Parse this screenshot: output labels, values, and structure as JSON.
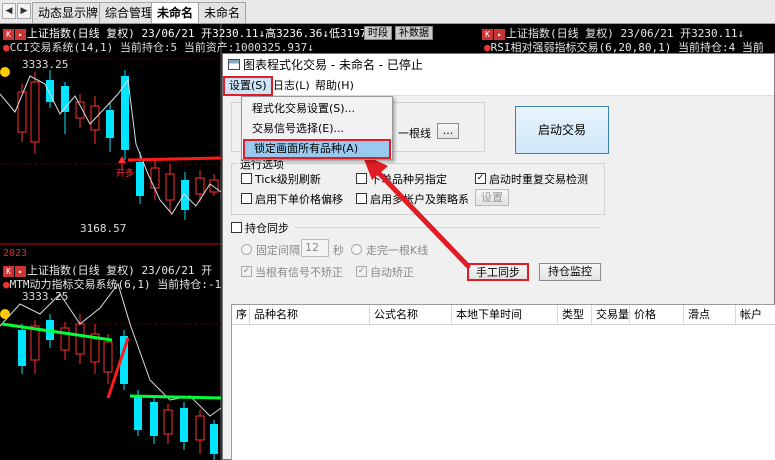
{
  "tabbar": {
    "nav_prev": "◀",
    "nav_next": "▶",
    "tabs": [
      "动态显示牌",
      "综合管理",
      "未命名",
      "未命名"
    ]
  },
  "chart_top": {
    "line1_left": "上证指数(日线 复权) 23/06/21 开3230.11↓高3236.36↓低3197.",
    "btn_period": "时段",
    "btn_supp": "补数据",
    "line2_left": "CCI交易系统(14,1) 当前持仓:5 当前资产:1000325.937↓",
    "line1_right": "上证指数(日线 复权) 23/06/21 开3230.11↓",
    "line2_right": "RSI相对强弱指标交易(6,20,80,1) 当前持仓:4 当前",
    "price_high": "3333.25",
    "price_low": "3168.57",
    "signal_label": "开多"
  },
  "chart_bottom": {
    "year": "2023",
    "line1": "上证指数(日线 复权) 23/06/21 开",
    "line2": "MTM动力指标交易系统(6,1) 当前持仓:-1",
    "price_high": "3333.25"
  },
  "dialog": {
    "title": "图表程式化交易 - 未命名 - 已停止",
    "menus": [
      "设置(S)",
      "日志(L)",
      "帮助(H)"
    ],
    "dropdown": [
      "程式化交易设置(S)...",
      "交易信号选择(E)...",
      "锁定画面所有品种(A)"
    ],
    "hidden_text": "一根线",
    "dots_button": "...",
    "start_button": "启动交易",
    "run_options_label": "运行选项",
    "options": {
      "tick_refresh": "Tick级别刷新",
      "order_specify": "下单品种另指定",
      "restart_check": "启动时重复交易检测",
      "price_offset": "启用下单价格偏移",
      "multi_account": "启用多帐户及策略系",
      "settings_button": "设置"
    },
    "sync": {
      "label": "持仓同步",
      "fixed_interval": "固定间隔",
      "interval_value": "12",
      "seconds": "秒",
      "complete_bar": "走完一根K线",
      "no_correct": "当根有信号不矫正",
      "auto_correct": "自动矫正",
      "manual_sync_button": "手工同步",
      "monitor_button": "持仓监控"
    },
    "table": {
      "columns": [
        "序",
        "品种名称",
        "公式名称",
        "本地下单时间",
        "类型",
        "交易量",
        "价格",
        "滑点",
        "帐户"
      ]
    }
  },
  "colors": {
    "highlight_box": "#e01c24",
    "up_candle": "#ff3030",
    "down_candle": "#00e5ff",
    "signal_line": "#ff1a1a",
    "green_line": "#00ff3a"
  }
}
